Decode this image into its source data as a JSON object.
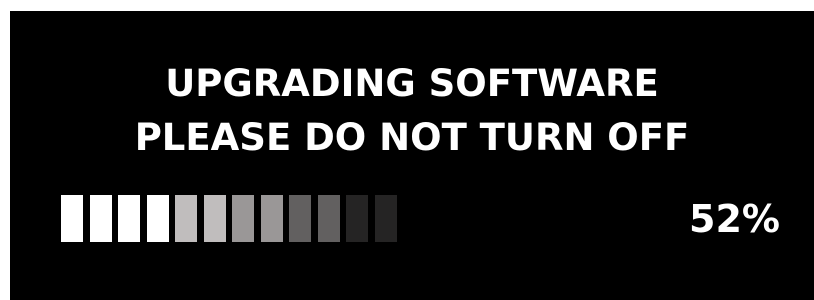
{
  "message": {
    "line1": "UPGRADING SOFTWARE",
    "line2": "PLEASE DO NOT TURN OFF"
  },
  "progress": {
    "percent_label": "52%",
    "segments": [
      {
        "color": "#ffffff"
      },
      {
        "color": "#ffffff"
      },
      {
        "color": "#ffffff"
      },
      {
        "color": "#ffffff"
      },
      {
        "color": "#c0bdbd"
      },
      {
        "color": "#c0bdbd"
      },
      {
        "color": "#9a9797"
      },
      {
        "color": "#9a9797"
      },
      {
        "color": "#626060"
      },
      {
        "color": "#626060"
      },
      {
        "color": "#252424"
      },
      {
        "color": "#252424"
      }
    ]
  },
  "colors": {
    "background": "#000000",
    "text": "#ffffff"
  }
}
